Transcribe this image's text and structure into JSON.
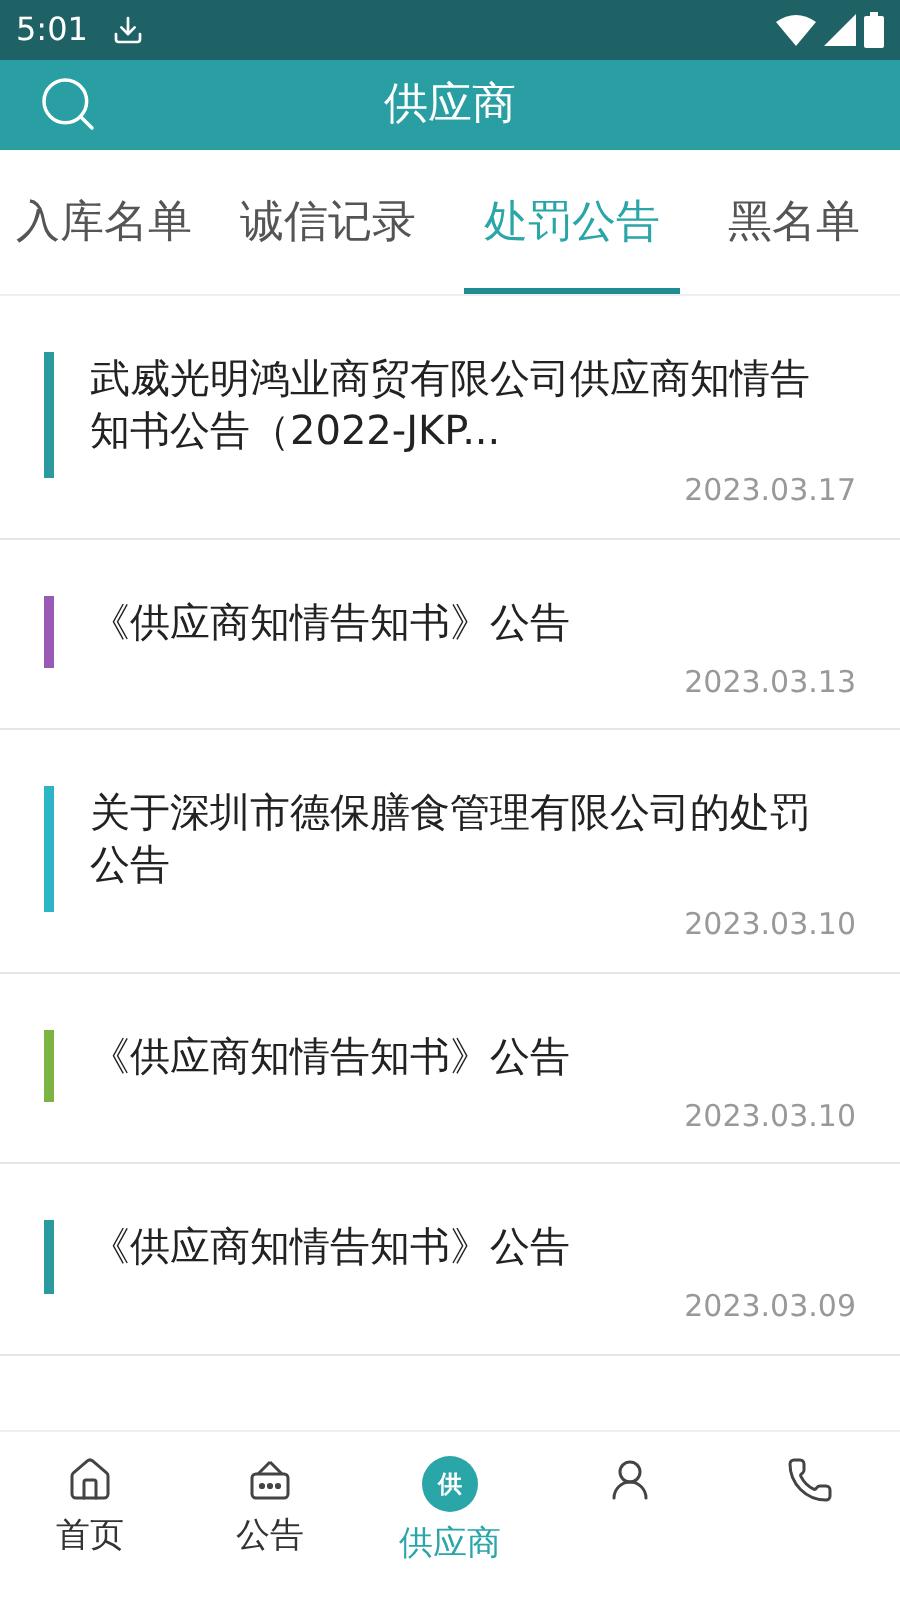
{
  "status_bar": {
    "time": "5:01"
  },
  "header": {
    "title": "供应商"
  },
  "tabs": [
    {
      "label": "入库名单",
      "selected": false
    },
    {
      "label": "诚信记录",
      "selected": false
    },
    {
      "label": "处罚公告",
      "selected": true
    },
    {
      "label": "黑名单",
      "selected": false
    }
  ],
  "notices": [
    {
      "title": "武威光明鸿业商贸有限公司供应商知情告知书公告（2022-JKP...",
      "date": "2023.03.17",
      "color": "#2a9a9e"
    },
    {
      "title": "《供应商知情告知书》公告",
      "date": "2023.03.13",
      "color": "#9b59b6"
    },
    {
      "title": "关于深圳市德保膳食管理有限公司的处罚公告",
      "date": "2023.03.10",
      "color": "#2bb5c7"
    },
    {
      "title": "《供应商知情告知书》公告",
      "date": "2023.03.10",
      "color": "#7cb342"
    },
    {
      "title": "《供应商知情告知书》公告",
      "date": "2023.03.09",
      "color": "#2a9a9e"
    }
  ],
  "bottom_nav": [
    {
      "kind": "home",
      "label": "首页",
      "selected": false
    },
    {
      "kind": "notice",
      "label": "公告",
      "selected": false
    },
    {
      "kind": "supplier",
      "label": "供应商",
      "badge": "供",
      "selected": true
    },
    {
      "kind": "person",
      "selected": false
    },
    {
      "kind": "phone",
      "selected": false
    }
  ]
}
